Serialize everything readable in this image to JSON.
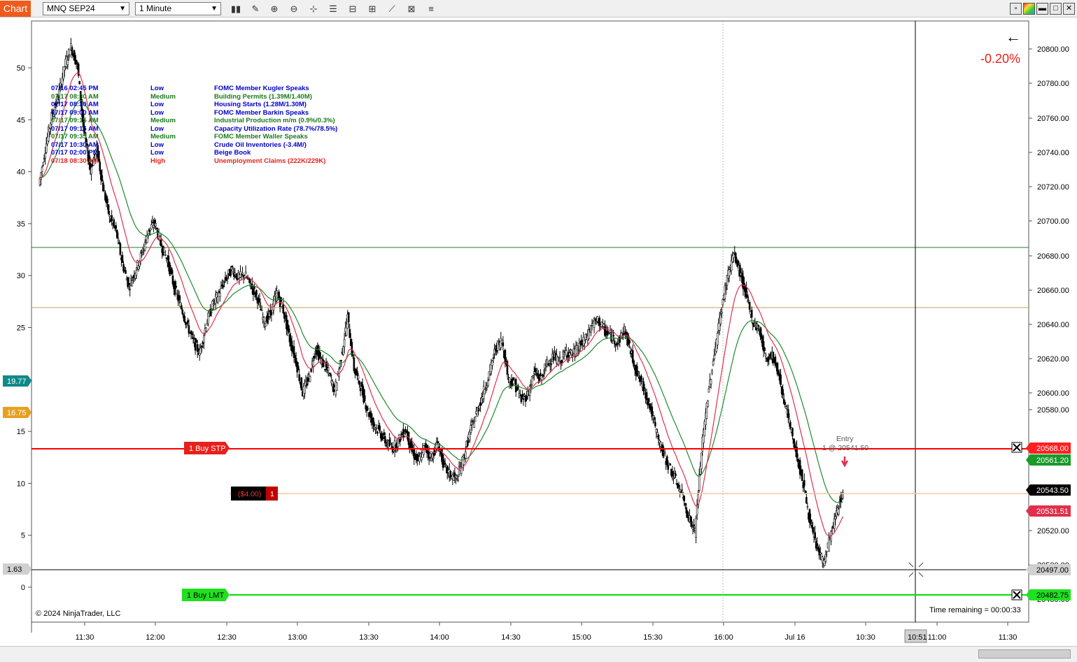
{
  "toolbar": {
    "tab_label": "Chart",
    "instrument": "MNQ SEP24",
    "interval": "1 Minute",
    "icons": [
      "bar-type-icon",
      "draw-icon",
      "zoom-in-icon",
      "zoom-out-icon",
      "crosshair-icon",
      "properties-icon",
      "templates-icon",
      "strategies-icon",
      "indicators-icon",
      "data-box-icon",
      "more-icon"
    ],
    "window_icons": [
      "restore-icon",
      "color-icon",
      "minimize-icon",
      "maximize-icon",
      "close-icon"
    ]
  },
  "chart": {
    "percent_change": "-0.20%",
    "back_arrow": "←",
    "copyright": "© 2024 NinjaTrader, LLC",
    "time_remaining": "Time remaining = 00:00:33",
    "colors": {
      "up_ma": "#1e8a2e",
      "down_ma": "#e0304c",
      "stop_line": "#ff0000",
      "limit_line": "#00e000",
      "position_line": "#f0c8a0",
      "level_line_green": "#2a7a2a",
      "level_line_orange": "#c8a050"
    },
    "left_axis": {
      "ticks": [
        "50",
        "45",
        "40",
        "35",
        "30",
        "25",
        "20",
        "15",
        "10",
        "5",
        "0"
      ],
      "markers": [
        {
          "text": "19.77",
          "color": "#0e8a8a"
        },
        {
          "text": "16.75",
          "color": "#e8a020"
        },
        {
          "text": "1.63",
          "color": "#d0d0d0"
        }
      ]
    },
    "right_axis": {
      "ticks": [
        "20800.00",
        "20780.00",
        "20760.00",
        "20740.00",
        "20720.00",
        "20700.00",
        "20680.00",
        "20660.00",
        "20640.00",
        "20620.00",
        "20600.00",
        "20580.00",
        "20520.00",
        "20500.00",
        "20480.00"
      ],
      "markers": [
        {
          "text": "20568.00",
          "color": "#ff2020"
        },
        {
          "text": "20561.20",
          "color": "#1a9a2a"
        },
        {
          "text": "20543.50",
          "color": "#000000"
        },
        {
          "text": "20531.51",
          "color": "#e0304c"
        },
        {
          "text": "20497.00",
          "color": "#d0d0d0"
        },
        {
          "text": "20482.75",
          "color": "#20e020"
        }
      ]
    },
    "x_axis": {
      "ticks": [
        "11:30",
        "12:00",
        "12:30",
        "13:00",
        "13:30",
        "14:00",
        "14:30",
        "15:00",
        "15:30",
        "16:00",
        "Jul 16",
        "10:30",
        "11:00",
        "11:30"
      ],
      "cursor_time": "10:51"
    },
    "orders": {
      "stop_label": "1  Buy STP",
      "limit_label": "1  Buy LMT",
      "pnl_label": "($4.00)",
      "qty_label": "1",
      "entry_label": "Entry",
      "entry_price": "1 @ 20541.50"
    },
    "events": [
      {
        "time": "07/16 02:45 PM",
        "impact": "Low",
        "name": "FOMC Member Kugler Speaks"
      },
      {
        "time": "07/17 08:30 AM",
        "impact": "Medium",
        "name": "Building Permits (1.39M/1.40M)"
      },
      {
        "time": "07/17 08:30 AM",
        "impact": "Low",
        "name": "Housing Starts (1.28M/1.30M)"
      },
      {
        "time": "07/17 09:00 AM",
        "impact": "Low",
        "name": "FOMC Member Barkin Speaks"
      },
      {
        "time": "07/17 09:15 AM",
        "impact": "Medium",
        "name": "Industrial Production m/m (0.9%/0.3%)"
      },
      {
        "time": "07/17 09:15 AM",
        "impact": "Low",
        "name": "Capacity Utilization Rate (78.7%/78.5%)"
      },
      {
        "time": "07/17 09:35 AM",
        "impact": "Medium",
        "name": "FOMC Member Waller Speaks"
      },
      {
        "time": "07/17 10:30 AM",
        "impact": "Low",
        "name": "Crude Oil Inventories (-3.4M/)"
      },
      {
        "time": "07/17 02:00 PM",
        "impact": "Low",
        "name": "Beige Book"
      },
      {
        "time": "07/18 08:30 AM",
        "impact": "High",
        "name": "Unemployment Claims (222K/229K)"
      }
    ],
    "impact_colors": {
      "Low": "#0000cc",
      "Medium": "#1a7a1a",
      "High": "#e8201c"
    }
  },
  "chart_data": {
    "type": "candlestick",
    "price_anchor_close": 20543.5,
    "closes": [
      20721,
      20742,
      20761,
      20772,
      20790,
      20801,
      20790,
      20752,
      20730,
      20742,
      20719,
      20702,
      20694,
      20675,
      20662,
      20671,
      20681,
      20694,
      20699,
      20686,
      20677,
      20662,
      20651,
      20640,
      20630,
      20623,
      20640,
      20651,
      20658,
      20666,
      20672,
      20667,
      20669,
      20662,
      20655,
      20641,
      20646,
      20658,
      20648,
      20631,
      20618,
      20600,
      20609,
      20626,
      20618,
      20612,
      20601,
      20621,
      20644,
      20614,
      20604,
      20591,
      20582,
      20577,
      20571,
      20568,
      20573,
      20579,
      20566,
      20560,
      20569,
      20562,
      20571,
      20557,
      20552,
      20550,
      20562,
      20577,
      20588,
      20599,
      20611,
      20626,
      20631,
      20608,
      20605,
      20596,
      20599,
      20612,
      20608,
      20617,
      20621,
      20618,
      20624,
      20622,
      20627,
      20631,
      20640,
      20642,
      20636,
      20633,
      20629,
      20637,
      20624,
      20611,
      20603,
      20592,
      20577,
      20565,
      20557,
      20549,
      20541,
      20528,
      20519,
      20566,
      20598,
      20623,
      20646,
      20667,
      20681,
      20670,
      20656,
      20641,
      20637,
      20620,
      20622,
      20611,
      20593,
      20577,
      20561,
      20544,
      20522,
      20510,
      20501,
      20516,
      20530,
      20543
    ]
  }
}
